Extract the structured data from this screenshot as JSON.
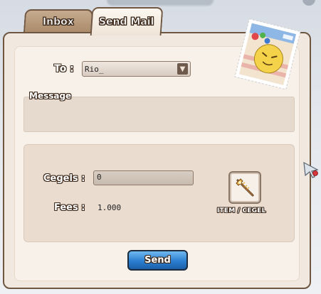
{
  "tabs": [
    {
      "label": "Inbox",
      "active": false
    },
    {
      "label": "Send Mail",
      "active": true
    }
  ],
  "form": {
    "to_label": "To :",
    "to_value": "Rio_",
    "message_label": "Message",
    "message_value": "",
    "cegels_label": "Cegels :",
    "cegels_value": "0",
    "fees_label": "Fees :",
    "fees_value": "1.000",
    "item_label": "ITEM / CEGEL"
  },
  "send_label": "Send",
  "icons": {
    "dropdown": "chevron-down-icon",
    "item": "staff-icon",
    "stamp": "stamp-icon",
    "cursor": "cursor-icon"
  },
  "colors": {
    "panel": "#f1e8df",
    "border": "#6f5641",
    "send_button": "#2b7fd1"
  }
}
